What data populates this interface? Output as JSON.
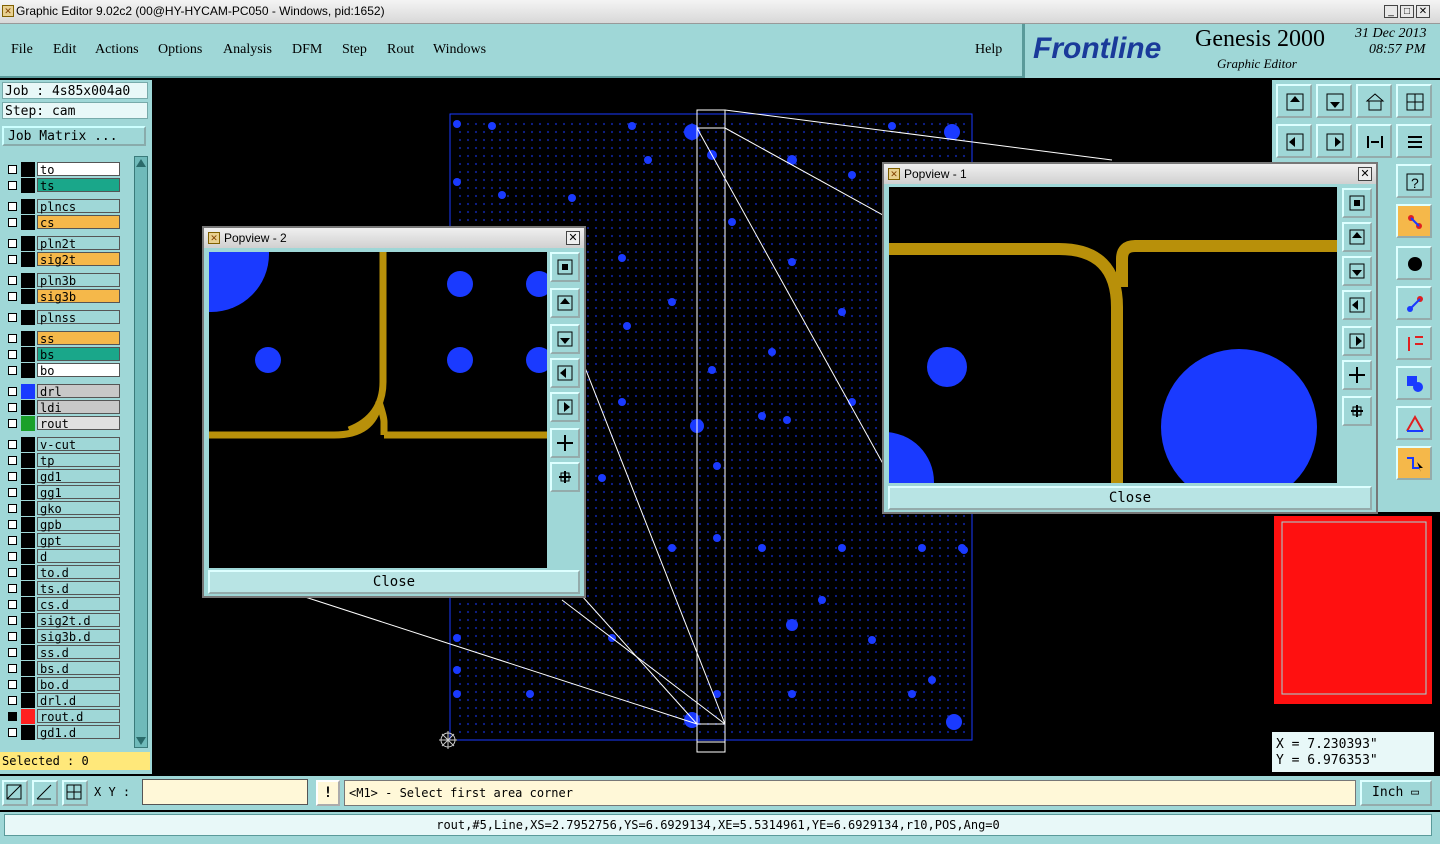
{
  "window": {
    "title": "Graphic Editor 9.02c2 (00@HY-HYCAM-PC050 - Windows, pid:1652)",
    "minimize": "_",
    "maximize": "□",
    "close": "✕"
  },
  "menubar": {
    "items": [
      {
        "label": "File"
      },
      {
        "label": "Edit"
      },
      {
        "label": "Actions"
      },
      {
        "label": "Options"
      },
      {
        "label": "Analysis"
      },
      {
        "label": "DFM"
      },
      {
        "label": "Step"
      },
      {
        "label": "Rout"
      },
      {
        "label": "Windows"
      }
    ],
    "help": "Help"
  },
  "brand": {
    "logo": "Frontline",
    "product": "Genesis 2000",
    "subtitle": "Graphic Editor",
    "date": "31 Dec 2013",
    "time": "08:57 PM"
  },
  "job": {
    "job_line": "Job : 4s85x004a0",
    "step_line": "Step: cam",
    "matrix_button": "Job Matrix ..."
  },
  "layers": [
    {
      "name": "to",
      "color": "#ffffff",
      "swatch": "#000000",
      "checked": false
    },
    {
      "name": "ts",
      "color": "#1aa78a",
      "swatch": "#000000",
      "checked": false
    },
    {
      "name": "plncs",
      "color": "#9fd7d7",
      "swatch": "#000000",
      "checked": false
    },
    {
      "name": "cs",
      "color": "#f5b84a",
      "swatch": "#000000",
      "checked": false
    },
    {
      "name": "pln2t",
      "color": "#9fd7d7",
      "swatch": "#000000",
      "checked": false
    },
    {
      "name": "sig2t",
      "color": "#f5b84a",
      "swatch": "#000000",
      "checked": false
    },
    {
      "name": "pln3b",
      "color": "#9fd7d7",
      "swatch": "#000000",
      "checked": false
    },
    {
      "name": "sig3b",
      "color": "#f5b84a",
      "swatch": "#000000",
      "checked": false
    },
    {
      "name": "plnss",
      "color": "#9fd7d7",
      "swatch": "#000000",
      "checked": false
    },
    {
      "name": "ss",
      "color": "#f5b84a",
      "swatch": "#000000",
      "checked": false
    },
    {
      "name": "bs",
      "color": "#1aa78a",
      "swatch": "#000000",
      "checked": false
    },
    {
      "name": "bo",
      "color": "#ffffff",
      "swatch": "#000000",
      "checked": false
    },
    {
      "name": "drl",
      "color": "#c8c8c8",
      "swatch": "#1a3aff",
      "checked": false
    },
    {
      "name": "ldi",
      "color": "#c8c8c8",
      "swatch": "#000000",
      "checked": false
    },
    {
      "name": "rout",
      "color": "#e0e0e0",
      "swatch": "#1aa02a",
      "checked": false
    },
    {
      "name": "v-cut",
      "color": "#9fd7d7",
      "swatch": "#000000",
      "checked": false
    },
    {
      "name": "tp",
      "color": "#9fd7d7",
      "swatch": "#000000",
      "checked": false
    },
    {
      "name": "gd1",
      "color": "#9fd7d7",
      "swatch": "#000000",
      "checked": false
    },
    {
      "name": "gg1",
      "color": "#9fd7d7",
      "swatch": "#000000",
      "checked": false
    },
    {
      "name": "gko",
      "color": "#9fd7d7",
      "swatch": "#000000",
      "checked": false
    },
    {
      "name": "gpb",
      "color": "#9fd7d7",
      "swatch": "#000000",
      "checked": false
    },
    {
      "name": "gpt",
      "color": "#9fd7d7",
      "swatch": "#000000",
      "checked": false
    },
    {
      "name": "d",
      "color": "#9fd7d7",
      "swatch": "#000000",
      "checked": false
    },
    {
      "name": "to.d",
      "color": "#9fd7d7",
      "swatch": "#000000",
      "checked": false
    },
    {
      "name": "ts.d",
      "color": "#9fd7d7",
      "swatch": "#000000",
      "checked": false
    },
    {
      "name": "cs.d",
      "color": "#9fd7d7",
      "swatch": "#000000",
      "checked": false
    },
    {
      "name": "sig2t.d",
      "color": "#9fd7d7",
      "swatch": "#000000",
      "checked": false
    },
    {
      "name": "sig3b.d",
      "color": "#9fd7d7",
      "swatch": "#000000",
      "checked": false
    },
    {
      "name": "ss.d",
      "color": "#9fd7d7",
      "swatch": "#000000",
      "checked": false
    },
    {
      "name": "bs.d",
      "color": "#9fd7d7",
      "swatch": "#000000",
      "checked": false
    },
    {
      "name": "bo.d",
      "color": "#9fd7d7",
      "swatch": "#000000",
      "checked": false
    },
    {
      "name": "drl.d",
      "color": "#9fd7d7",
      "swatch": "#000000",
      "checked": false
    },
    {
      "name": "rout.d",
      "color": "#9fd7d7",
      "swatch": "#ff2020",
      "checked": true
    },
    {
      "name": "gd1.d",
      "color": "#9fd7d7",
      "swatch": "#000000",
      "checked": false
    }
  ],
  "selected": "Selected : 0",
  "popview2": {
    "title": "Popview - 2",
    "close_label": "Close"
  },
  "popview1": {
    "title": "Popview - 1",
    "close_label": "Close"
  },
  "coords": {
    "x": "X = 7.230393\"",
    "y": "Y = 6.976353\""
  },
  "command": {
    "xy_label": "X Y :",
    "xy_value": "",
    "bang": "!",
    "prompt": "<M1> - Select first area corner",
    "units": "Inch"
  },
  "status": "rout,#5,Line,XS=2.7952756,YS=6.6929134,XE=5.5314961,YE=6.6929134,r10,POS,Ang=0",
  "colors": {
    "panel": "#9fd7d7",
    "board_outline": "#1a3aff",
    "trace": "#b8900a",
    "pad": "#1a3aff",
    "overview": "#ff1010"
  }
}
